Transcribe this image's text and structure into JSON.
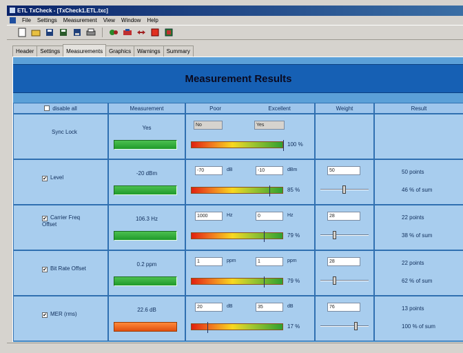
{
  "window": {
    "title": "ETL TxCheck - [TxCheck1.ETL.txc]"
  },
  "menu": [
    "File",
    "Settings",
    "Measurement",
    "View",
    "Window",
    "Help"
  ],
  "toolbar_icons": [
    "new-file-icon",
    "open-folder-icon",
    "save-icon",
    "save-as-icon",
    "save-all-icon",
    "print-icon",
    "connect-icon",
    "disconnect-icon",
    "transfer-icon",
    "stop-icon",
    "report-icon"
  ],
  "tabs": [
    "Header",
    "Settings",
    "Measurements",
    "Graphics",
    "Warnings",
    "Summary"
  ],
  "active_tab": "Measurements",
  "title": "Measurement Results",
  "columns": {
    "disable_all": "disable all",
    "measurement": "Measurement",
    "poor": "Poor",
    "excellent": "Excellent",
    "weight": "Weight",
    "result": "Result"
  },
  "rows": [
    {
      "name": "Sync Lock",
      "checkbox": false,
      "value": "Yes",
      "bar_color": "green",
      "poor_value": "No",
      "poor_unit": "",
      "excellent_value": "Yes",
      "excellent_unit": "",
      "quality_pct": "100 %",
      "quality_level": 1.0,
      "weight": "",
      "weight_level": null,
      "points": "",
      "share": ""
    },
    {
      "name": "Level",
      "checkbox": true,
      "value": "-20 dBm",
      "bar_color": "green",
      "poor_value": "-70",
      "poor_unit": "dB",
      "excellent_value": "-10",
      "excellent_unit": "dBm",
      "quality_pct": "85 %",
      "quality_level": 0.85,
      "weight": "50",
      "weight_level": 0.5,
      "points": "50 points",
      "share": "46 % of sum"
    },
    {
      "name": "Carrier Freq Offset",
      "checkbox": true,
      "value": "106.3 Hz",
      "bar_color": "green",
      "poor_value": "1000",
      "poor_unit": "Hz",
      "excellent_value": "0",
      "excellent_unit": "Hz",
      "quality_pct": "79 %",
      "quality_level": 0.79,
      "weight": "28",
      "weight_level": 0.28,
      "points": "22 points",
      "share": "38 % of sum"
    },
    {
      "name": "Bit Rate Offset",
      "checkbox": true,
      "value": "0.2 ppm",
      "bar_color": "green",
      "poor_value": "1",
      "poor_unit": "ppm",
      "excellent_value": "1",
      "excellent_unit": "ppm",
      "quality_pct": "79 %",
      "quality_level": 0.79,
      "weight": "28",
      "weight_level": 0.28,
      "points": "22 points",
      "share": "62 % of sum"
    },
    {
      "name": "MER (rms)",
      "checkbox": true,
      "value": "22.6 dB",
      "bar_color": "orange",
      "poor_value": "20",
      "poor_unit": "dB",
      "excellent_value": "35",
      "excellent_unit": "dB",
      "quality_pct": "17 %",
      "quality_level": 0.17,
      "weight": "76",
      "weight_level": 0.76,
      "points": "13 points",
      "share": "100 % of sum"
    }
  ]
}
